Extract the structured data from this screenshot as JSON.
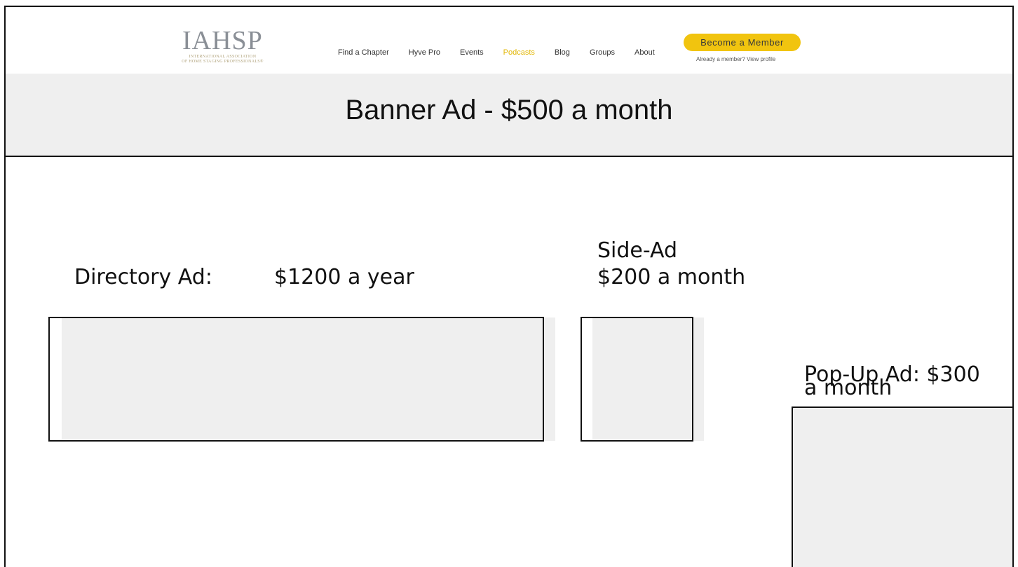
{
  "header": {
    "logo": {
      "name": "IAHSP",
      "sub_line1": "INTERNATIONAL ASSOCIATION",
      "sub_line2": "OF HOME STAGING PROFESSIONALS®"
    },
    "nav": [
      {
        "label": "Find a Chapter",
        "active": false
      },
      {
        "label": "Hyve Pro",
        "active": false
      },
      {
        "label": "Events",
        "active": false
      },
      {
        "label": "Podcasts",
        "active": true
      },
      {
        "label": "Blog",
        "active": false
      },
      {
        "label": "Groups",
        "active": false
      },
      {
        "label": "About",
        "active": false
      }
    ],
    "cta_label": "Become a Member",
    "cta_sub": "Already a member? View profile"
  },
  "banner": {
    "text": "Banner Ad - $500 a month"
  },
  "ads": {
    "directory_label": "Directory Ad:",
    "directory_price": "$1200 a year",
    "side_title": "Side-Ad",
    "side_price": "$200 a month",
    "popup_line1": "Pop-Up Ad: $300",
    "popup_line2": "a month"
  },
  "colors": {
    "accent": "#f1c40f",
    "active_nav": "#e2b706",
    "placeholder": "#efefef"
  }
}
